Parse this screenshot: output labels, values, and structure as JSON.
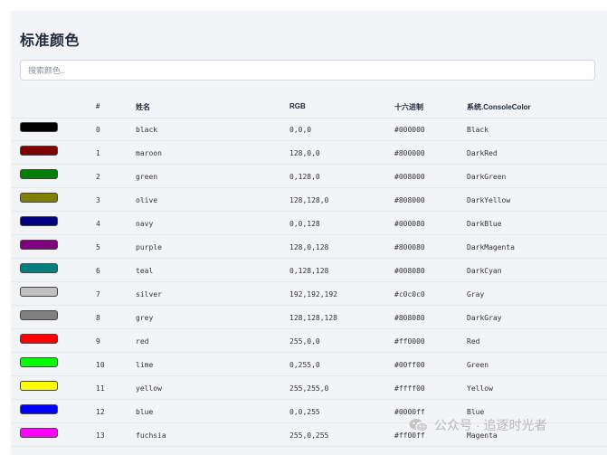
{
  "page": {
    "title": "标准颜色",
    "search_placeholder": "搜索颜色.."
  },
  "table": {
    "headers": [
      "#",
      "姓名",
      "RGB",
      "十六进制",
      "系统.ConsoleColor"
    ],
    "rows": [
      {
        "index": "0",
        "name": "black",
        "rgb": "0,0,0",
        "hex": "#000000",
        "console": "Black",
        "color": "#000000"
      },
      {
        "index": "1",
        "name": "maroon",
        "rgb": "128,0,0",
        "hex": "#800000",
        "console": "DarkRed",
        "color": "#800000"
      },
      {
        "index": "2",
        "name": "green",
        "rgb": "0,128,0",
        "hex": "#008000",
        "console": "DarkGreen",
        "color": "#008000"
      },
      {
        "index": "3",
        "name": "olive",
        "rgb": "128,128,0",
        "hex": "#808000",
        "console": "DarkYellow",
        "color": "#808000"
      },
      {
        "index": "4",
        "name": "navy",
        "rgb": "0,0,128",
        "hex": "#000080",
        "console": "DarkBlue",
        "color": "#000080"
      },
      {
        "index": "5",
        "name": "purple",
        "rgb": "128,0,128",
        "hex": "#800080",
        "console": "DarkMagenta",
        "color": "#800080"
      },
      {
        "index": "6",
        "name": "teal",
        "rgb": "0,128,128",
        "hex": "#008080",
        "console": "DarkCyan",
        "color": "#008080"
      },
      {
        "index": "7",
        "name": "silver",
        "rgb": "192,192,192",
        "hex": "#c0c0c0",
        "console": "Gray",
        "color": "#c0c0c0"
      },
      {
        "index": "8",
        "name": "grey",
        "rgb": "128,128,128",
        "hex": "#808080",
        "console": "DarkGray",
        "color": "#808080"
      },
      {
        "index": "9",
        "name": "red",
        "rgb": "255,0,0",
        "hex": "#ff0000",
        "console": "Red",
        "color": "#ff0000"
      },
      {
        "index": "10",
        "name": "lime",
        "rgb": "0,255,0",
        "hex": "#00ff00",
        "console": "Green",
        "color": "#00ff00"
      },
      {
        "index": "11",
        "name": "yellow",
        "rgb": "255,255,0",
        "hex": "#ffff00",
        "console": "Yellow",
        "color": "#ffff00"
      },
      {
        "index": "12",
        "name": "blue",
        "rgb": "0,0,255",
        "hex": "#0000ff",
        "console": "Blue",
        "color": "#0000ff"
      },
      {
        "index": "13",
        "name": "fuchsia",
        "rgb": "255,0,255",
        "hex": "#ff00ff",
        "console": "Magenta",
        "color": "#ff00ff"
      }
    ]
  },
  "watermark": {
    "text": "公众号 · 追逐时光者",
    "icon": "wechat-icon"
  }
}
